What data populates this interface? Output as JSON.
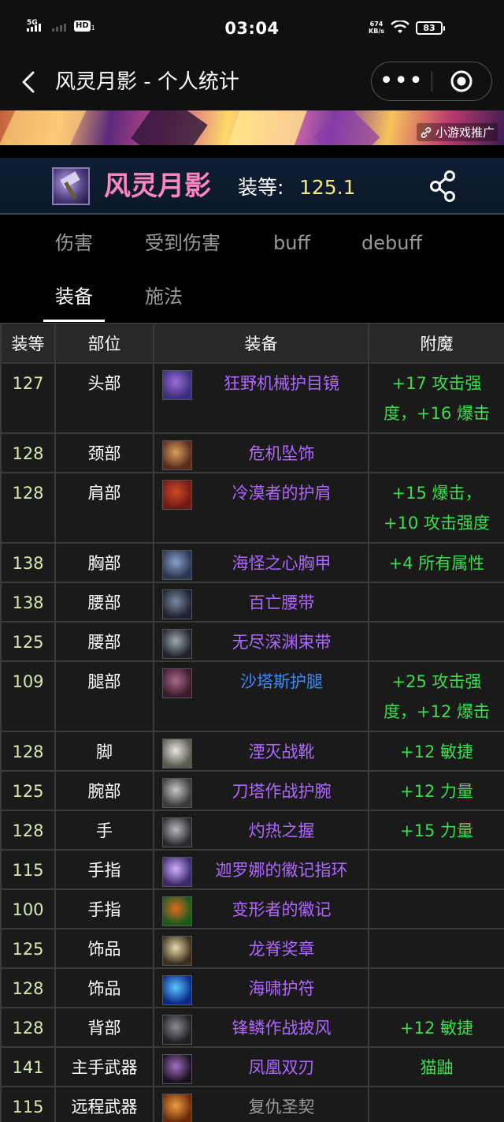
{
  "status_bar": {
    "network_left": "5G",
    "hd_label": "HD",
    "hd_sub": "1",
    "time": "03:04",
    "speed_value": "674",
    "speed_unit": "KB/s",
    "battery": "83"
  },
  "nav": {
    "title": "风灵月影 - 个人统计",
    "more_glyph": "•••"
  },
  "ad": {
    "tag": "小游戏推广"
  },
  "character": {
    "name": "风灵月影",
    "ilvl_label": "装等:",
    "ilvl_value": "125.1"
  },
  "tabs": [
    "伤害",
    "受到伤害",
    "buff",
    "debuff",
    "装备",
    "施法"
  ],
  "active_tab": "装备",
  "table": {
    "headers": [
      "装等",
      "部位",
      "装备",
      "附魔"
    ],
    "rows": [
      {
        "ilvl": "127",
        "slot": "头部",
        "item": "狂野机械护目镜",
        "ench": "+17 攻击强度，+16 爆击",
        "icon": "goggles-icon",
        "icon_colors": [
          "#3a2f7a",
          "#9a6dd8"
        ],
        "quality": "epic",
        "tall": true
      },
      {
        "ilvl": "128",
        "slot": "颈部",
        "item": "危机坠饰",
        "ench": "",
        "icon": "pendant-icon",
        "icon_colors": [
          "#5a2a1e",
          "#d8a05a"
        ],
        "quality": "epic",
        "tall": false
      },
      {
        "ilvl": "128",
        "slot": "肩部",
        "item": "冷漠者的护肩",
        "ench": "+15 爆击，+10 攻击强度",
        "icon": "shoulder-icon",
        "icon_colors": [
          "#6e1a14",
          "#d04a28"
        ],
        "quality": "epic",
        "tall": true
      },
      {
        "ilvl": "138",
        "slot": "胸部",
        "item": "海怪之心胸甲",
        "ench": "+4 所有属性",
        "icon": "chest-icon",
        "icon_colors": [
          "#2a3550",
          "#8aa0c8"
        ],
        "quality": "epic",
        "tall": false
      },
      {
        "ilvl": "138",
        "slot": "腰部",
        "item": "百亡腰带",
        "ench": "",
        "icon": "belt-icon",
        "icon_colors": [
          "#1e2230",
          "#7a8aa0"
        ],
        "quality": "epic",
        "tall": false
      },
      {
        "ilvl": "125",
        "slot": "腰部",
        "item": "无尽深渊束带",
        "ench": "",
        "icon": "belt-icon",
        "icon_colors": [
          "#20242a",
          "#a0a8b0"
        ],
        "quality": "epic",
        "tall": false
      },
      {
        "ilvl": "109",
        "slot": "腿部",
        "item": "沙塔斯护腿",
        "ench": "+25 攻击强度，+12 爆击",
        "icon": "legs-icon",
        "icon_colors": [
          "#3a1a2a",
          "#a86a8a"
        ],
        "quality": "rare",
        "tall": true
      },
      {
        "ilvl": "128",
        "slot": "脚",
        "item": "湮灭战靴",
        "ench": "+12 敏捷",
        "icon": "boots-icon",
        "icon_colors": [
          "#5a5a50",
          "#e8e6dc"
        ],
        "quality": "epic",
        "tall": false
      },
      {
        "ilvl": "125",
        "slot": "腕部",
        "item": "刀塔作战护腕",
        "ench": "+12 力量",
        "icon": "bracer-icon",
        "icon_colors": [
          "#3a3a3a",
          "#c8c8c8"
        ],
        "quality": "epic",
        "tall": false
      },
      {
        "ilvl": "128",
        "slot": "手",
        "item": "灼热之握",
        "ench": "+15 力量",
        "icon": "gloves-icon",
        "icon_colors": [
          "#2a2a2e",
          "#b8b8c0"
        ],
        "quality": "epic",
        "tall": false
      },
      {
        "ilvl": "115",
        "slot": "手指",
        "item": "迦罗娜的徽记指环",
        "ench": "",
        "icon": "ring-icon",
        "icon_colors": [
          "#3a2a6a",
          "#d0b0ff"
        ],
        "quality": "epic",
        "tall": false
      },
      {
        "ilvl": "100",
        "slot": "手指",
        "item": "变形者的徽记",
        "ench": "",
        "icon": "ring-icon",
        "icon_colors": [
          "#1a5a1e",
          "#e06a20"
        ],
        "quality": "epic",
        "tall": false
      },
      {
        "ilvl": "125",
        "slot": "饰品",
        "item": "龙脊奖章",
        "ench": "",
        "icon": "trinket-icon",
        "icon_colors": [
          "#3a3020",
          "#e8d8a8"
        ],
        "quality": "epic",
        "tall": false
      },
      {
        "ilvl": "128",
        "slot": "饰品",
        "item": "海啸护符",
        "ench": "",
        "icon": "trinket-icon",
        "icon_colors": [
          "#0a2a8a",
          "#5ac8ff"
        ],
        "quality": "epic",
        "tall": false
      },
      {
        "ilvl": "128",
        "slot": "背部",
        "item": "锋鳞作战披风",
        "ench": "+12 敏捷",
        "icon": "cloak-icon",
        "icon_colors": [
          "#202024",
          "#8a8a90"
        ],
        "quality": "epic",
        "tall": false
      },
      {
        "ilvl": "141",
        "slot": "主手武器",
        "item": "凤凰双刃",
        "ench": "猫鼬",
        "icon": "weapon-icon",
        "icon_colors": [
          "#1a1020",
          "#a070c0"
        ],
        "quality": "epic",
        "tall": false
      },
      {
        "ilvl": "115",
        "slot": "远程武器",
        "item": "复仇圣契",
        "ench": "",
        "icon": "relic-icon",
        "icon_colors": [
          "#6a2a0a",
          "#f0a040"
        ],
        "quality": "common",
        "tall": false
      }
    ]
  }
}
